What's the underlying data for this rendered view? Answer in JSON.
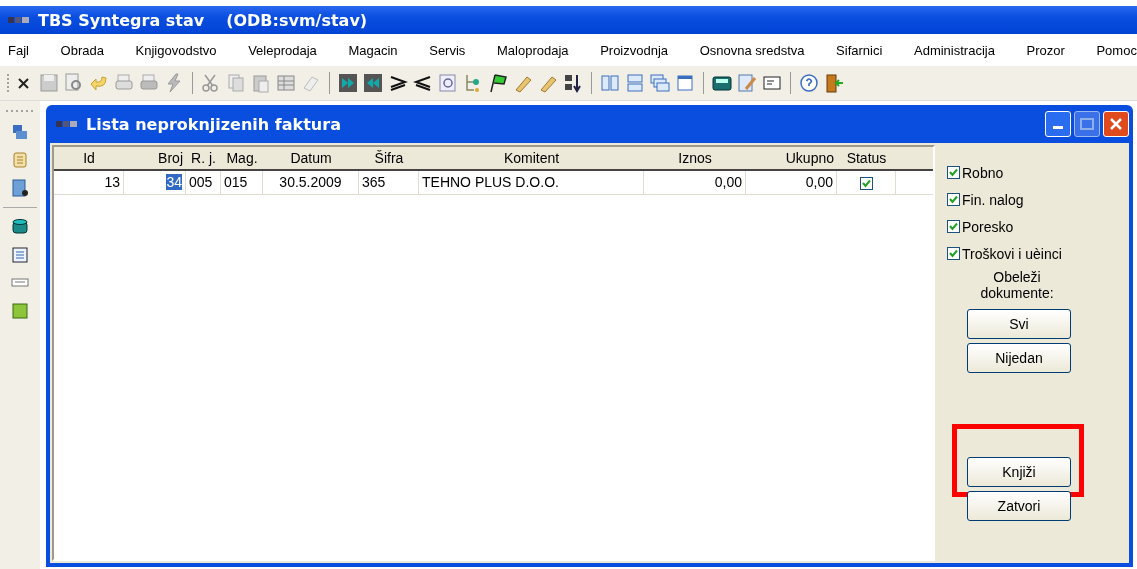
{
  "app_window": {
    "title": "TBS Syntegra stav",
    "subtitle": "(ODB:svm/stav)"
  },
  "menu_bar": [
    "Fajl",
    "Obrada",
    "Knjigovodstvo",
    "Veleprodaja",
    "Magacin",
    "Servis",
    "Maloprodaja",
    "Proizvodnja",
    "Osnovna sredstva",
    "Sifarnici",
    "Administracija",
    "Prozor",
    "Pomoc"
  ],
  "child_window": {
    "title": "Lista neproknjizenih faktura",
    "maximize_disabled": true
  },
  "table": {
    "columns": [
      "Id",
      "Broj",
      "R. j.",
      "Mag.",
      "Datum",
      "Šifra",
      "Komitent",
      "Iznos",
      "Ukupno",
      "Status"
    ],
    "rows": [
      {
        "cells": [
          {
            "text": "13",
            "selected": false
          },
          {
            "text": "34",
            "selected": true
          },
          {
            "text": "005",
            "selected": false
          },
          {
            "text": "015",
            "selected": false
          },
          {
            "text": "30.5.2009",
            "selected": false
          },
          {
            "text": "365",
            "selected": false
          },
          {
            "text": "TEHNO PLUS D.O.O.",
            "selected": false
          },
          {
            "text": "0,00",
            "selected": false
          },
          {
            "text": "0,00",
            "selected": false
          }
        ],
        "status_checked": true
      }
    ]
  },
  "options": [
    {
      "label": "Robno",
      "checked": true
    },
    {
      "label": "Fin. nalog",
      "checked": true
    },
    {
      "label": "Poresko",
      "checked": true
    },
    {
      "label": "Troškovi i uèinci",
      "checked": true
    }
  ],
  "mark_label": "Obeleži dokumente:",
  "mark_buttons": [
    "Svi",
    "Nijedan"
  ],
  "action_buttons": [
    {
      "label": "Knjiži",
      "highlighted": true
    },
    {
      "label": "Zatvori",
      "highlighted": false
    }
  ]
}
